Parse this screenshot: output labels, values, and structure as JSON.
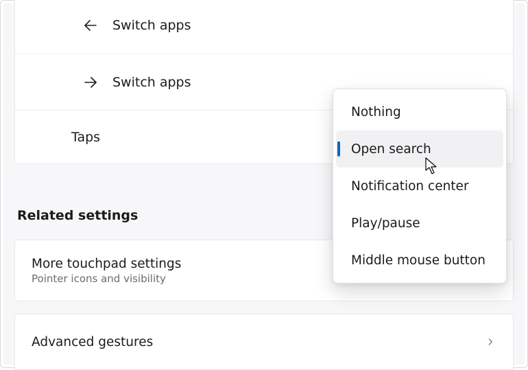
{
  "gestures": {
    "row1_label": "Switch apps",
    "row2_label": "Switch apps",
    "taps_label": "Taps"
  },
  "section_header": "Related settings",
  "cards": {
    "more_title": "More touchpad settings",
    "more_sub": "Pointer icons and visibility",
    "advanced_title": "Advanced gestures"
  },
  "menu": {
    "items": [
      "Nothing",
      "Open search",
      "Notification center",
      "Play/pause",
      "Middle mouse button"
    ]
  }
}
